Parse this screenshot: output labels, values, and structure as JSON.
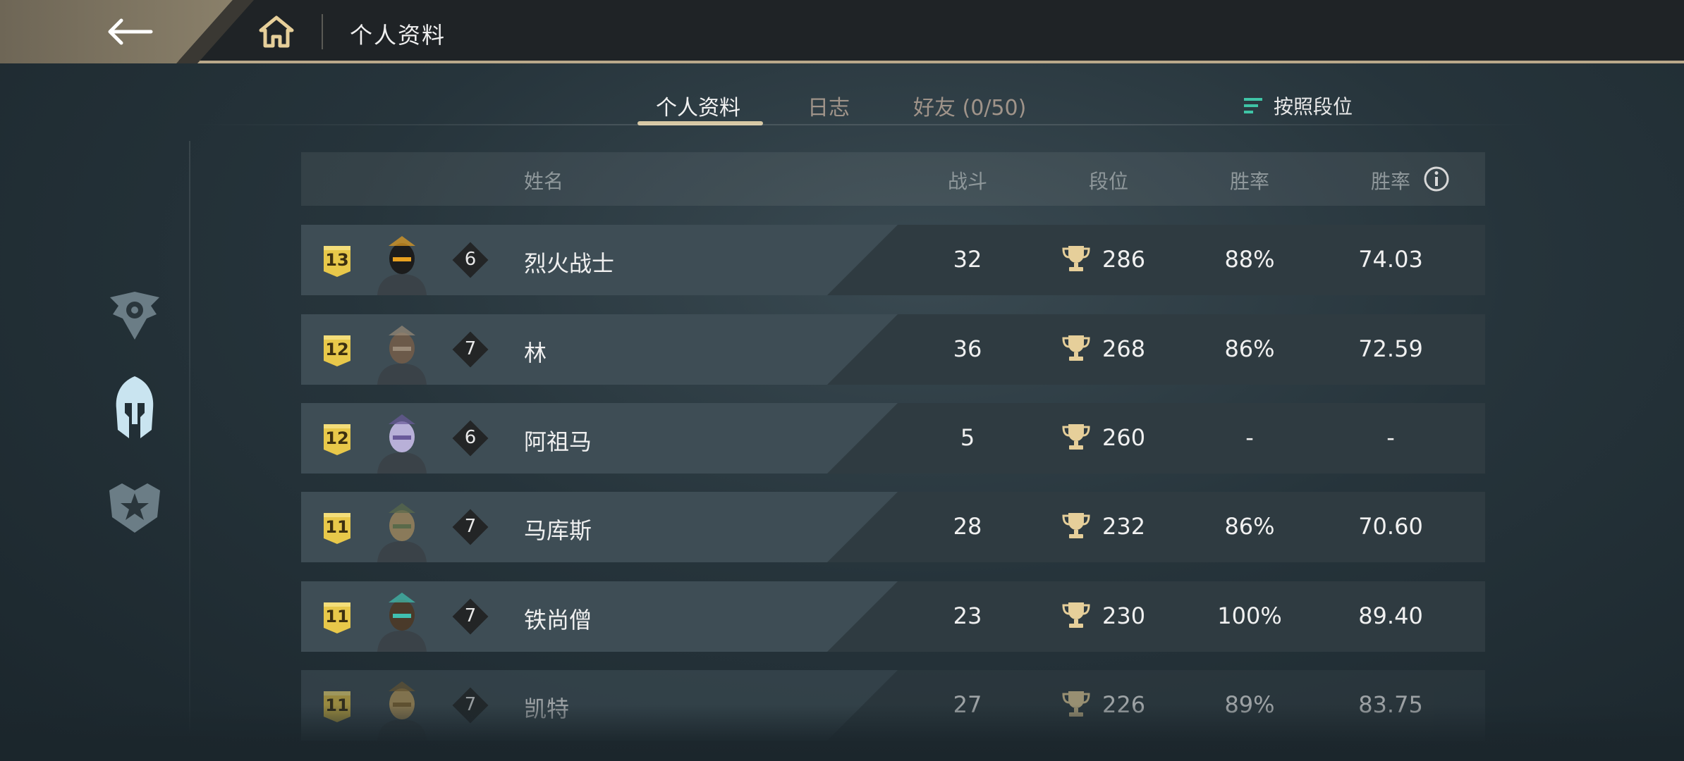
{
  "topbar": {
    "back_icon": "arrow-left-icon",
    "home_icon": "home-icon",
    "title": "个人资料"
  },
  "tabs": [
    {
      "label": "个人资料",
      "active": true
    },
    {
      "label": "日志",
      "active": false
    },
    {
      "label": "好友 (0/50)",
      "active": false
    }
  ],
  "sort": {
    "icon": "sort-lines-icon",
    "label": "按照段位"
  },
  "sidebar": {
    "items": [
      {
        "icon": "clan-emblem-icon",
        "active": false
      },
      {
        "icon": "spartan-helmet-icon",
        "active": true
      },
      {
        "icon": "star-crest-icon",
        "active": false
      }
    ]
  },
  "table": {
    "headers": {
      "name": "姓名",
      "battles": "战斗",
      "rank": "段位",
      "winrate": "胜率",
      "winrate2": "胜率"
    },
    "info_icon": "info-icon",
    "rows": [
      {
        "badge": "13",
        "level": "6",
        "name": "烈火战士",
        "battles": "32",
        "rank": "286",
        "winrate": "88%",
        "score": "74.03"
      },
      {
        "badge": "12",
        "level": "7",
        "name": "林",
        "battles": "36",
        "rank": "268",
        "winrate": "86%",
        "score": "72.59"
      },
      {
        "badge": "12",
        "level": "6",
        "name": "阿祖马",
        "battles": "5",
        "rank": "260",
        "winrate": "-",
        "score": "-"
      },
      {
        "badge": "11",
        "level": "7",
        "name": "马库斯",
        "battles": "28",
        "rank": "232",
        "winrate": "86%",
        "score": "70.60"
      },
      {
        "badge": "11",
        "level": "7",
        "name": "铁尚僧",
        "battles": "23",
        "rank": "230",
        "winrate": "100%",
        "score": "89.40"
      },
      {
        "badge": "11",
        "level": "7",
        "name": "凯特",
        "battles": "27",
        "rank": "226",
        "winrate": "89%",
        "score": "83.75"
      }
    ]
  },
  "colors": {
    "accent_gold": "#d6c7a3",
    "badge_gold": "#e8c84a",
    "trophy_gold": "#e6cf9a",
    "sort_icon": "#3fc4a6"
  }
}
